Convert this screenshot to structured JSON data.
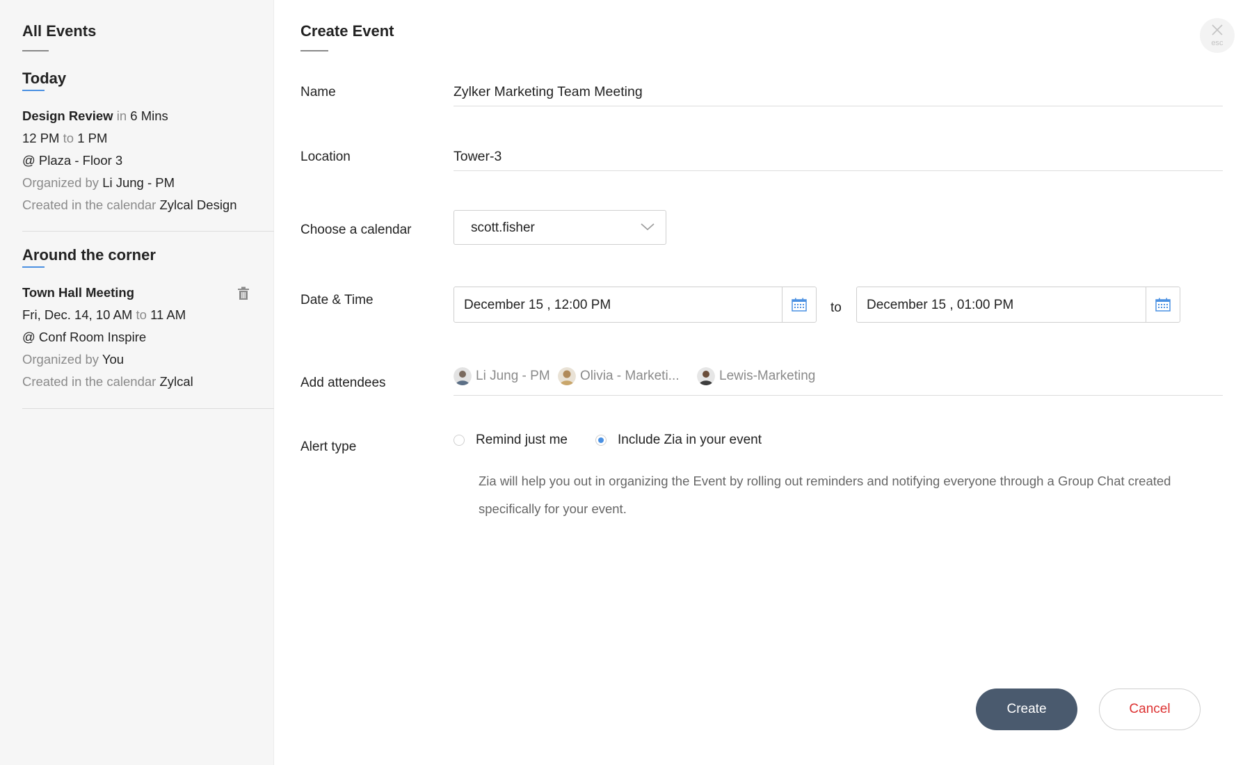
{
  "sidebar": {
    "title": "All Events",
    "today": {
      "heading": "Today",
      "event": {
        "name": "Design Review",
        "in_word": "in",
        "eta": "6 Mins",
        "start": "12 PM",
        "to_word": "to",
        "end": "1 PM",
        "location": "@ Plaza - Floor 3",
        "organized_label": "Organized by",
        "organizer": "Li Jung - PM",
        "calendar_label": "Created in the calendar",
        "calendar": "Zylcal Design"
      }
    },
    "around": {
      "heading": "Around the corner",
      "event": {
        "name": "Town Hall Meeting",
        "start": "Fri, Dec. 14, 10 AM",
        "to_word": "to",
        "end": "11 AM",
        "location": "@ Conf Room Inspire",
        "organized_label": "Organized by",
        "organizer": "You",
        "calendar_label": "Created in the calendar",
        "calendar": "Zylcal"
      }
    }
  },
  "main": {
    "title": "Create Event",
    "close_esc": "esc",
    "name": {
      "label": "Name",
      "value": "Zylker Marketing Team Meeting"
    },
    "location": {
      "label": "Location",
      "value": "Tower-3"
    },
    "calendar": {
      "label": "Choose a calendar",
      "value": "scott.fisher"
    },
    "datetime": {
      "label": "Date & Time",
      "start": "December 15 , 12:00 PM",
      "to_word": "to",
      "end": "December 15 , 01:00 PM"
    },
    "attendees": {
      "label": "Add attendees",
      "items": [
        {
          "name": "Li Jung - PM"
        },
        {
          "name": "Olivia - Marketi..."
        },
        {
          "name": "Lewis-Marketing"
        }
      ]
    },
    "alert": {
      "label": "Alert type",
      "options": [
        {
          "label": "Remind just me",
          "selected": false
        },
        {
          "label": "Include Zia in your event",
          "selected": true
        }
      ],
      "help": "Zia will help you out in organizing the Event by rolling out reminders and notifying everyone through a Group Chat created specifically for your event."
    },
    "buttons": {
      "create": "Create",
      "cancel": "Cancel"
    }
  },
  "colors": {
    "accent": "#4a90e2",
    "primary_button": "#4a5a6e",
    "cancel_text": "#dd3333",
    "sidebar_bg": "#f6f6f6"
  }
}
